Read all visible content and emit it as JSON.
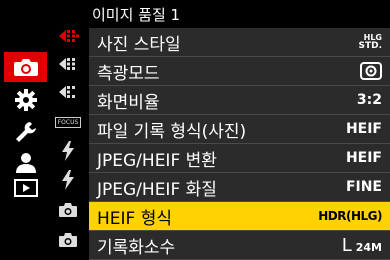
{
  "header": {
    "title": "이미지 품질 1"
  },
  "main_tabs": [
    {
      "icon": "camera-icon",
      "active": true
    },
    {
      "icon": "gear-icon",
      "active": false
    },
    {
      "icon": "wrench-icon",
      "active": false
    },
    {
      "icon": "person-icon",
      "active": false
    },
    {
      "icon": "playback-icon",
      "active": false
    }
  ],
  "sub_tabs": [
    {
      "icon": "image-quality-icon"
    },
    {
      "icon": "focus-icon",
      "label": "FOCUS"
    },
    {
      "icon": "flash-icon"
    },
    {
      "icon": "flash-icon"
    },
    {
      "icon": "camera-small-icon"
    },
    {
      "icon": "camera-small-icon"
    }
  ],
  "rows": [
    {
      "label": "사진 스타일",
      "value": "STD.",
      "value_prefix": "HLG",
      "value_kind": "photo-style"
    },
    {
      "label": "측광모드",
      "value": "",
      "value_kind": "metering-icon"
    },
    {
      "label": "화면비율",
      "value": "3:2"
    },
    {
      "label": "파일 기록 형식(사진)",
      "value": "HEIF"
    },
    {
      "label": "JPEG/HEIF 변환",
      "value": "HEIF"
    },
    {
      "label": "JPEG/HEIF 화질",
      "value": "FINE"
    },
    {
      "label": "HEIF 형식",
      "value": "HDR(HLG)",
      "selected": true
    },
    {
      "label": "기록화소수",
      "value": "24M",
      "value_prefix": "L"
    }
  ],
  "colors": {
    "accent_red": "#e00000",
    "selected_yellow": "#ffd200",
    "list_bg": "#2b2b2b"
  }
}
